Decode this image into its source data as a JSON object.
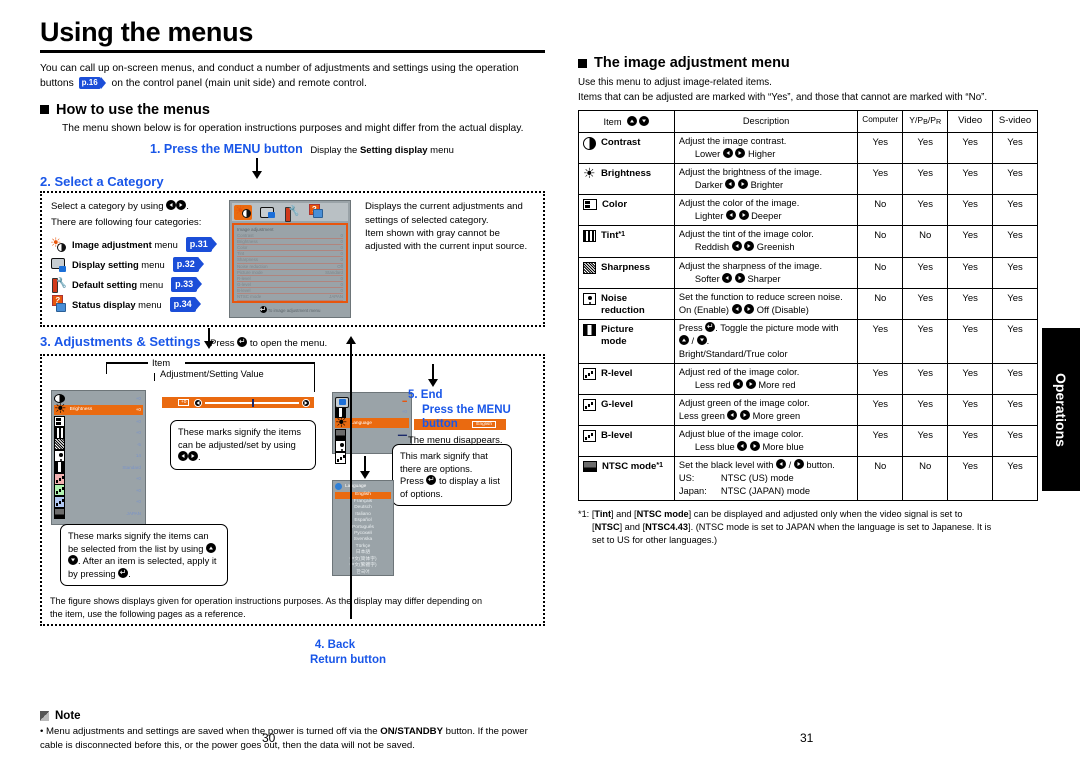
{
  "document": {
    "title": "Using the menus",
    "intro_part1": "You can call up on-screen menus, and conduct a number of adjustments and settings using the operation buttons",
    "intro_ref": "p.16",
    "intro_part2": "on the control panel (main unit side) and remote control.",
    "side_tab": "Operations",
    "page_left": "30",
    "page_right": "31"
  },
  "how_to": {
    "heading": "How to use the menus",
    "lead": "The menu shown below is for operation instructions purposes and might differ from the actual display."
  },
  "step1": {
    "label": "1. Press the MENU button",
    "note_pre": "Display the",
    "note_bold": "Setting display",
    "note_post": "menu"
  },
  "step2": {
    "label": "2. Select a Category",
    "instruction_pre": "Select a category by using",
    "instruction_post": ".",
    "lead2": "There are following four categories:",
    "categories": [
      {
        "icon": "image-adjustment-icon",
        "name": "Image adjustment",
        "suffix": "menu",
        "page": "p.31"
      },
      {
        "icon": "display-setting-icon",
        "name": "Display setting",
        "suffix": "menu",
        "page": "p.32"
      },
      {
        "icon": "default-setting-icon",
        "name": "Default setting",
        "suffix": "menu",
        "page": "p.33"
      },
      {
        "icon": "status-display-icon",
        "name": "Status display",
        "suffix": "menu",
        "page": "p.34"
      }
    ],
    "right_text": "Displays the current adjustments and settings of selected category.\nItem shown with gray cannot be adjusted with the current input source.",
    "osd": {
      "heading": "Image adjustment",
      "footer": "To image adjustment menu",
      "rows": [
        {
          "label": "Contrast",
          "value": "0"
        },
        {
          "label": "Brightness",
          "value": "0"
        },
        {
          "label": "Color",
          "value": "0"
        },
        {
          "label": "Tint",
          "value": "0"
        },
        {
          "label": "Sharpness",
          "value": "0"
        },
        {
          "label": "Noise reduction",
          "value": "Off"
        },
        {
          "label": "Picture mode",
          "value": "Standard"
        },
        {
          "label": "R-level",
          "value": "0"
        },
        {
          "label": "G-level",
          "value": "0"
        },
        {
          "label": "B-level",
          "value": "0"
        },
        {
          "label": "NTSC mode",
          "value": "JAPAN"
        }
      ]
    }
  },
  "step3": {
    "label": "3. Adjustments & Settings",
    "note_pre": "Press",
    "note_post": "to open the menu.",
    "caption_item": "Item",
    "caption_value": "Adjustment/Setting Value",
    "callout_adjust": "These marks signify the items can be adjusted/set by using",
    "callout_options_l1": "This mark signify that there are options.",
    "callout_options_l2_pre": "Press",
    "callout_options_l2_post": "to display a list of options.",
    "callout_list_pre": "These marks signify the items can be selected from the list by using",
    "callout_list_mid": ".",
    "callout_list_post_pre": "After an item is selected, apply it by pressing",
    "callout_list_post_end": ".",
    "figure_note": "The figure shows displays given for operation instructions purposes.  As the display may differ depending on the item, use the following pages as a reference.",
    "mock_a": {
      "selected_label": "Brightness",
      "selected_value": "+0",
      "values": [
        "+0",
        "+0",
        "+0",
        "-5",
        "14",
        "Standard",
        "+0",
        "+0",
        "+0",
        "JAPAN"
      ]
    },
    "mock_b": {
      "selected_label": "Language",
      "selected_value": "English",
      "values": [
        "",
        "+0",
        "",
        "",
        "On",
        "On"
      ]
    },
    "language_menu": {
      "heading": "Language",
      "items": [
        "English",
        "Français",
        "Deutsch",
        "Italiano",
        "Español",
        "Português",
        "Русский",
        "Svenska",
        "Türkçe",
        "日本語",
        "中文(简体字)",
        "中文(繁體字)",
        "한국어"
      ],
      "selected": "English"
    }
  },
  "step4": {
    "line1": "4. Back",
    "line2": "Return button"
  },
  "step5": {
    "line1": "5. End",
    "line2": "Press the MENU",
    "line3": "button",
    "desc": "The menu disappears."
  },
  "note": {
    "heading": "Note",
    "bullet_pre": "Menu adjustments and settings are saved when the power is turned off via the",
    "bullet_bold1": "ON/",
    "bullet_bold2": "STANDBY",
    "bullet_post": "button. If the power cable is disconnected before this, or the power goes out, then the data will not be saved."
  },
  "image_menu": {
    "heading": "The image adjustment menu",
    "lead1": "Use this menu to adjust image-related items.",
    "lead2": "Items that can be adjusted are marked with  “Yes”, and those that cannot are marked with “No”.",
    "columns": {
      "item": "Item",
      "description": "Description",
      "computer": "Computer",
      "ypbpr_main": "Y/P",
      "ypbpr_b": "B",
      "ypbpr_slash": "/P",
      "ypbpr_r": "R",
      "video": "Video",
      "svideo": "S-video"
    },
    "rows": [
      {
        "icon": "contrast-icon",
        "name": "Contrast",
        "footnote": "",
        "desc1": "Adjust the image contrast.",
        "desc2_left": "Lower",
        "desc2_right": "Higher",
        "desc2_indent": true,
        "computer": "Yes",
        "ypbpr": "Yes",
        "video": "Yes",
        "svideo": "Yes"
      },
      {
        "icon": "brightness-icon",
        "name": "Brightness",
        "footnote": "",
        "desc1": "Adjust the brightness of the image.",
        "desc2_left": "Darker",
        "desc2_right": "Brighter",
        "desc2_indent": true,
        "computer": "Yes",
        "ypbpr": "Yes",
        "video": "Yes",
        "svideo": "Yes"
      },
      {
        "icon": "color-icon",
        "name": "Color",
        "footnote": "",
        "desc1": "Adjust the color of the image.",
        "desc2_left": "Lighter",
        "desc2_right": "Deeper",
        "desc2_indent": true,
        "computer": "No",
        "ypbpr": "Yes",
        "video": "Yes",
        "svideo": "Yes"
      },
      {
        "icon": "tint-icon",
        "name": "Tint",
        "footnote": "*1",
        "desc1": "Adjust the tint of the image color.",
        "desc2_left": "Reddish",
        "desc2_right": "Greenish",
        "desc2_indent": true,
        "computer": "No",
        "ypbpr": "No",
        "video": "Yes",
        "svideo": "Yes"
      },
      {
        "icon": "sharpness-icon",
        "name": "Sharpness",
        "footnote": "",
        "desc1": "Adjust the sharpness of the image.",
        "desc2_left": "Softer",
        "desc2_right": "Sharper",
        "desc2_indent": true,
        "computer": "No",
        "ypbpr": "Yes",
        "video": "Yes",
        "svideo": "Yes"
      },
      {
        "icon": "noise-reduction-icon",
        "name": "Noise\nreduction",
        "footnote": "",
        "desc1": "Set the function to reduce screen noise.",
        "desc2_left": "On (Enable)",
        "desc2_right": "Off (Disable)",
        "desc2_indent": false,
        "computer": "No",
        "ypbpr": "Yes",
        "video": "Yes",
        "svideo": "Yes"
      },
      {
        "icon": "picture-mode-icon",
        "name": "Picture\nmode",
        "footnote": "",
        "desc_special": "picture_mode",
        "desc_press": "Press",
        "desc_toggle": ". Toggle the picture mode with",
        "desc_slash": "/",
        "desc_period": ".",
        "desc_modes": "Bright/Standard/True color",
        "computer": "Yes",
        "ypbpr": "Yes",
        "video": "Yes",
        "svideo": "Yes"
      },
      {
        "icon": "r-level-icon",
        "name": "R-level",
        "footnote": "",
        "desc1": "Adjust red of the image color.",
        "desc2_left": "Less red",
        "desc2_right": "More red",
        "desc2_indent": true,
        "computer": "Yes",
        "ypbpr": "Yes",
        "video": "Yes",
        "svideo": "Yes"
      },
      {
        "icon": "g-level-icon",
        "name": "G-level",
        "footnote": "",
        "desc1": "Adjust green of the image color.",
        "desc2_left": "Less green",
        "desc2_right": "More green",
        "desc2_indent": false,
        "computer": "Yes",
        "ypbpr": "Yes",
        "video": "Yes",
        "svideo": "Yes"
      },
      {
        "icon": "b-level-icon",
        "name": "B-level",
        "footnote": "",
        "desc1": "Adjust blue of the image color.",
        "desc2_left": "Less blue",
        "desc2_right": "More blue",
        "desc2_indent": true,
        "computer": "Yes",
        "ypbpr": "Yes",
        "video": "Yes",
        "svideo": "Yes"
      },
      {
        "icon": "ntsc-mode-icon",
        "name": "NTSC mode",
        "footnote": "*1",
        "desc_special": "ntsc",
        "desc_black_pre": "Set the black level with",
        "desc_black_mid": "/",
        "desc_black_post": "button.",
        "desc_us": "US:",
        "desc_us_v": "NTSC (US) mode",
        "desc_jp": "Japan:",
        "desc_jp_v": "NTSC (JAPAN) mode",
        "computer": "No",
        "ypbpr": "No",
        "video": "Yes",
        "svideo": "Yes"
      }
    ],
    "footnote": {
      "marker": "*1:",
      "p1": "[",
      "b1": "Tint",
      "p2": "] and [",
      "b2": "NTSC mode",
      "p3": "] can be displayed and adjusted only when the video signal is set to",
      "p4": "[",
      "b3": "NTSC",
      "p5": "] and [",
      "b4": "NTSC4.43",
      "p6": "]. (NTSC mode is set to JAPAN when the language is set to Japanese. It is",
      "p7": "set to US for other languages.)"
    }
  }
}
